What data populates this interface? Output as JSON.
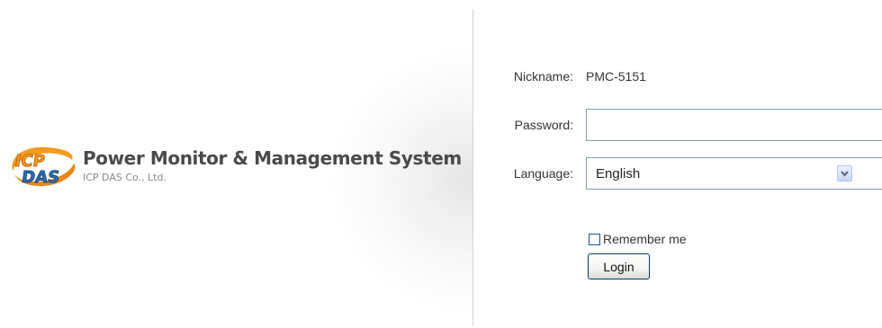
{
  "brand": {
    "logo_text": "ICP DAS",
    "title": "Power Monitor & Management System",
    "subtitle": "ICP DAS Co., Ltd."
  },
  "form": {
    "nickname_label": "Nickname:",
    "nickname_value": "PMC-5151",
    "password_label": "Password:",
    "password_value": "",
    "language_label": "Language:",
    "language_selected": "English",
    "remember_label": "Remember me",
    "remember_checked": false,
    "login_label": "Login"
  },
  "icons": {
    "logo": "icpdas-logo",
    "dropdown": "chevron-down-icon",
    "checkbox": "checkbox-unchecked"
  },
  "colors": {
    "brand_orange": "#f39a1f",
    "brand_blue": "#2a6fb3",
    "input_border": "#7f9db9",
    "text": "#333333"
  }
}
